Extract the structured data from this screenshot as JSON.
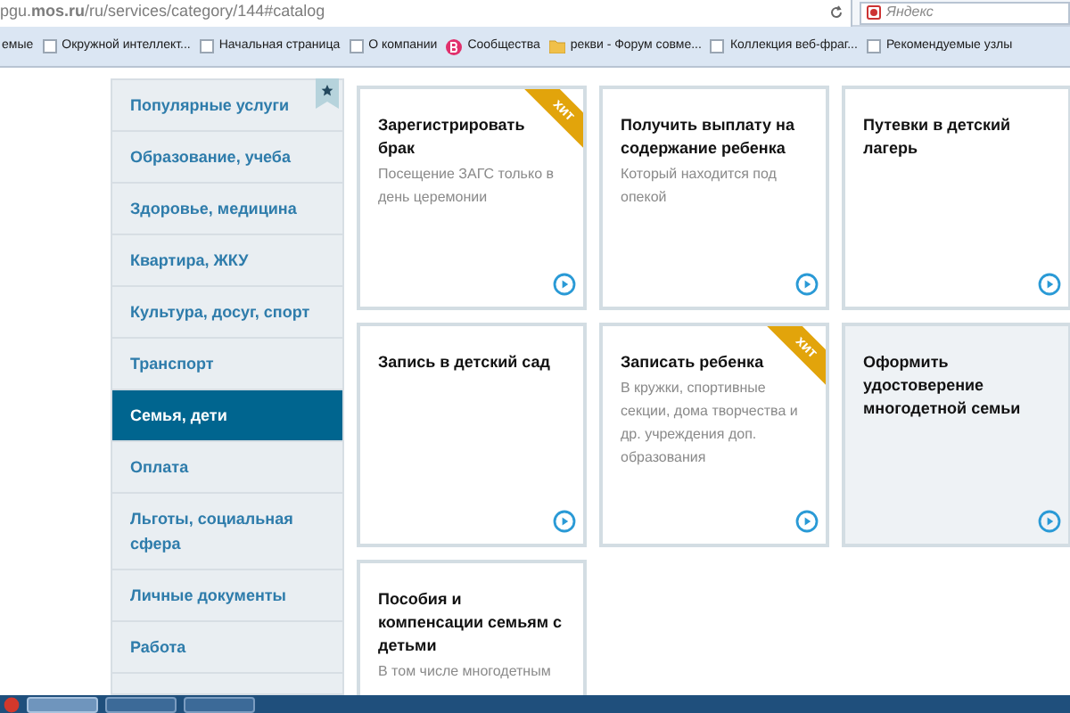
{
  "browser": {
    "address": "pgu.**mos.ru**/ru/services/category/144#catalog",
    "search": {
      "placeholder": "Яндекс"
    },
    "bookmarks": [
      {
        "label": "емые",
        "kind": "cut"
      },
      {
        "label": "Окружной интеллект...",
        "kind": "page"
      },
      {
        "label": "Начальная страница",
        "kind": "page"
      },
      {
        "label": "О компании",
        "kind": "page"
      },
      {
        "label": "Сообщества",
        "kind": "community"
      },
      {
        "label": "рекви - Форум совме...",
        "kind": "folder"
      },
      {
        "label": "Коллекция веб-фраг...",
        "kind": "page"
      },
      {
        "label": "Рекомендуемые узлы",
        "kind": "page"
      }
    ]
  },
  "sidebar": {
    "items": [
      {
        "label": "Популярные услуги",
        "selected": false
      },
      {
        "label": "Образование, учеба",
        "selected": false
      },
      {
        "label": "Здоровье, медицина",
        "selected": false
      },
      {
        "label": "Квартира, ЖКУ",
        "selected": false
      },
      {
        "label": "Культура, досуг, спорт",
        "selected": false
      },
      {
        "label": "Транспорт",
        "selected": false
      },
      {
        "label": "Семья, дети",
        "selected": true
      },
      {
        "label": "Оплата",
        "selected": false
      },
      {
        "label": "Льготы, социальная сфера",
        "selected": false
      },
      {
        "label": "Личные документы",
        "selected": false
      },
      {
        "label": "Работа",
        "selected": false
      }
    ]
  },
  "cards": [
    {
      "title": "Зарегистрировать брак",
      "description": "Посещение ЗАГС только в день церемонии",
      "badge": "хит",
      "highlighted": false
    },
    {
      "title": "Получить выплату на содержание ребенка",
      "description": "Который находится под опекой",
      "highlighted": false
    },
    {
      "title": "Путевки в детский лагерь",
      "highlighted": false
    },
    {
      "title": "Запись в детский сад",
      "highlighted": false
    },
    {
      "title": "Записать ребенка",
      "description": "В кружки, спортивные секции, дома творчества и др. учреждения доп. образования",
      "badge": "хит",
      "highlighted": false
    },
    {
      "title": "Оформить удостоверение многодетной семьи",
      "highlighted": true
    },
    {
      "title": "Пособия и компенсации семьям с детьми",
      "description": "В том числе многодетным",
      "highlighted": false
    }
  ]
}
